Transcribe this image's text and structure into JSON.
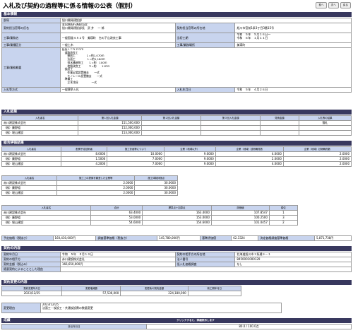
{
  "title": "入札及び契約の過程等に係る情報の公表（個別）",
  "top_buttons": [
    "前へ",
    "次へ",
    "戻る"
  ],
  "sections": {
    "basic": "基本情報",
    "bid_result": "入札結果",
    "eval_result": "総合評価結果",
    "contract": "契約の内容",
    "change": "契約変更の内容",
    "grade": "成績"
  },
  "basic": {
    "dept_label": "部局",
    "dept": "旭川開発建設部",
    "officer_label": "契約担当官等の氏名",
    "officer": "支出負担行為担当官\n旭川開発建設部長　武 井 　一 郎",
    "officer_addr_label": "契約担当官等の所在地",
    "officer_addr": "旭川市宮前1条3丁目3番15号",
    "work_name_label": "工事/業務名",
    "work_name": "一般国道４５２号　美瑛町　台の下山改良工事",
    "period_label": "当初工期",
    "period": "令和　５年　５月１６日～\n令和　６年　１月１１日",
    "type_label": "工事/業種区分",
    "type": "一般土木",
    "place_label": "工事/業務場所",
    "place": "美瑛町",
    "summary_label": "工事/業務概要",
    "summary": "延長Ｌ＝５２０ｍ\n　道路改良工\n　　掘削工　　　　Ｌ=約1,070ｍ\n　　法面工 　　　　Ｌ=約1,180ｍ\n　　排水構造物工　　Ｌ=約　100ｍ\n　　地盤改良工　　　Ｖ=約　　11ｍ3\n　仮設工\n　　作業足場設置撤去　　一式\n　　モノレール設置撤去　　一式\n　準備工\n　　立木伐採　　　　　一式",
    "method_label": "入札等方式",
    "method": "一般競争入札",
    "bid_date_label": "入札年月日",
    "bid_date": "令和　５年　４月２６日"
  },
  "bid": {
    "headers": [
      "入札者名",
      "第１回入札金額",
      "第２回入札金額",
      "第３回入札金額",
      "見積金額",
      "入札等の結果"
    ],
    "rows": [
      [
        "赤川建設株式会社",
        "151,500,000",
        "",
        "",
        "",
        "落札"
      ],
      [
        "（株）廉野組",
        "152,000,000",
        "",
        "",
        "",
        ""
      ],
      [
        "（株）堀山建設",
        "153,000,000",
        "",
        "",
        "",
        ""
      ]
    ]
  },
  "eval1": {
    "headers": [
      "入札者名",
      "配置予定技術者",
      "施工計画等について",
      "企業（地域以外）",
      "企業（地域）技術職員数",
      "企業（地域）技術職員数"
    ],
    "rows": [
      [
        "赤川建設株式会社",
        "8.0000",
        "10.0000",
        "9.0000",
        "4.0000",
        "2.0000"
      ],
      [
        "（株）廉野組",
        "1.5000",
        "7.0000",
        "9.0000",
        "2.0000",
        "2.0000"
      ],
      [
        "（株）堀山建設",
        "4.2000",
        "7.0000",
        "9.0000",
        "4.0000",
        "2.0000"
      ]
    ]
  },
  "eval2": {
    "headers": [
      "入札者名",
      "施工上の提案を審査した企業等",
      "施工体制評価点"
    ],
    "rows": [
      [
        "赤川建設株式会社",
        "2.0000",
        "30.0000"
      ],
      [
        "（株）廉野組",
        "2.0000",
        "30.0000"
      ],
      [
        "（株）堀山建設",
        "2.0000",
        "30.0000"
      ]
    ]
  },
  "eval3": {
    "headers": [
      "入札者名",
      "合計",
      "標準点＋加算点",
      "評価値",
      "順位"
    ],
    "rows": [
      [
        "赤川建設株式会社",
        "63.4000",
        "163.4000",
        "107.8547",
        "1"
      ],
      [
        "（株）廉野組",
        "53.0000",
        "153.0000",
        "100.2500",
        "3"
      ],
      [
        "（株）堀山建設",
        "54.6000",
        "154.6000",
        "101.0457",
        "2"
      ]
    ]
  },
  "eval_summary": {
    "est_label": "予定価格（税抜き）",
    "est": "160,430,000円",
    "base_label": "調査基準価格（税抜き）",
    "base": "145,780,000円",
    "score_label": "基準評価値",
    "score": "62.3324",
    "min_label": "決定価格調査基準価格",
    "min": "5,871,738円"
  },
  "contract": {
    "date_label": "契約年月日",
    "date": "令和　５年　５月１０日",
    "addr_label": "契約の相手方の所在地",
    "addr": "北海道旭川市１条通９－１",
    "party_label": "契約の相手方",
    "party": "赤川建設株式会社",
    "corp_label": "法人番号",
    "corp": "8450001000129",
    "amount_label": "契約金額（税込み）",
    "amount": "166,650,000円",
    "low_label": "低入札価格調査",
    "low": "なし",
    "follow_label": "随意契約によることとした理由",
    "follow": ""
  },
  "change": {
    "headers": [
      "契約変更年月日",
      "変更増減額",
      "変更後の契約金額",
      "新工期年月日"
    ],
    "row": [
      "2023/12/25",
      "57,536,000",
      "224,180,000",
      ""
    ],
    "reason_label": "変更理由",
    "reason": "2023/12/25\n法面工・仮設工・共通仮設費の数量変更"
  },
  "grade": {
    "note": "クリックすると、詳細表示します",
    "header": "評点年月日",
    "value": "80.0 / 100.0点"
  }
}
